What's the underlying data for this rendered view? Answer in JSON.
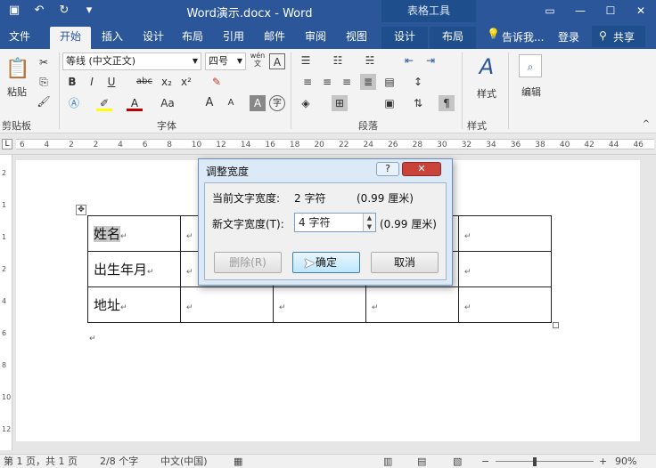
{
  "window": {
    "title": "Word演示.docx - Word",
    "contextual_tab_group": "表格工具"
  },
  "quick_access": {
    "save_icon": "save-icon",
    "undo_icon": "undo-icon",
    "redo_icon": "redo-icon",
    "customize_icon": "customize-qat-icon"
  },
  "tabs": [
    {
      "label": "文件"
    },
    {
      "label": "开始"
    },
    {
      "label": "插入"
    },
    {
      "label": "设计"
    },
    {
      "label": "布局"
    },
    {
      "label": "引用"
    },
    {
      "label": "邮件"
    },
    {
      "label": "审阅"
    },
    {
      "label": "视图"
    },
    {
      "label": "设计"
    },
    {
      "label": "布局"
    }
  ],
  "active_tab": "开始",
  "tell_me": "告诉我...",
  "login": "登录",
  "share": "共享",
  "ribbon": {
    "clipboard": {
      "paste_label": "粘贴",
      "group_label": "剪贴板"
    },
    "font": {
      "font_name": "等线 (中文正文)",
      "font_size": "四号",
      "group_label": "字体",
      "aa_label": "Aa",
      "wen_label": "wén",
      "wen_char": "文",
      "a_label": "A",
      "zi_label": "字",
      "bold": "B",
      "italic": "I",
      "underline": "U",
      "strike": "abc",
      "sub": "x₂",
      "sup": "x²"
    },
    "paragraph": {
      "group_label": "段落"
    },
    "styles": {
      "label": "样式",
      "group_label": "样式"
    },
    "editing": {
      "label": "编辑"
    }
  },
  "ruler": {
    "numbers": [
      "6",
      "4",
      "2",
      "2",
      "4",
      "6",
      "8",
      "10",
      "12",
      "14",
      "16",
      "18",
      "20",
      "22",
      "24",
      "26",
      "28",
      "30",
      "32",
      "34",
      "36",
      "38",
      "40",
      "42",
      "44",
      "46"
    ],
    "vertical_numbers": [
      "2",
      "1",
      "1",
      "2",
      "4",
      "6",
      "8",
      "10",
      "12"
    ]
  },
  "document": {
    "rows": [
      [
        "姓名",
        "",
        "",
        "",
        "",
        ""
      ],
      [
        "出生年月",
        "",
        "",
        "",
        "",
        ""
      ],
      [
        "地址",
        "",
        "",
        "",
        "",
        ""
      ]
    ],
    "para_mark": "↵"
  },
  "dialog": {
    "title": "调整宽度",
    "help": "?",
    "close": "✕",
    "current_label": "当前文字宽度:",
    "current_value": "2 字符",
    "current_cm": "(0.99 厘米)",
    "new_label": "新文字宽度(T):",
    "new_value": "4 字符",
    "new_cm": "(0.99 厘米)",
    "delete_button": "删除(R)",
    "ok_button": "确定",
    "cancel_button": "取消"
  },
  "status": {
    "page": "第 1 页，共 1 页",
    "words": "2/8 个字",
    "language": "中文(中国)",
    "zoom": "90%"
  }
}
